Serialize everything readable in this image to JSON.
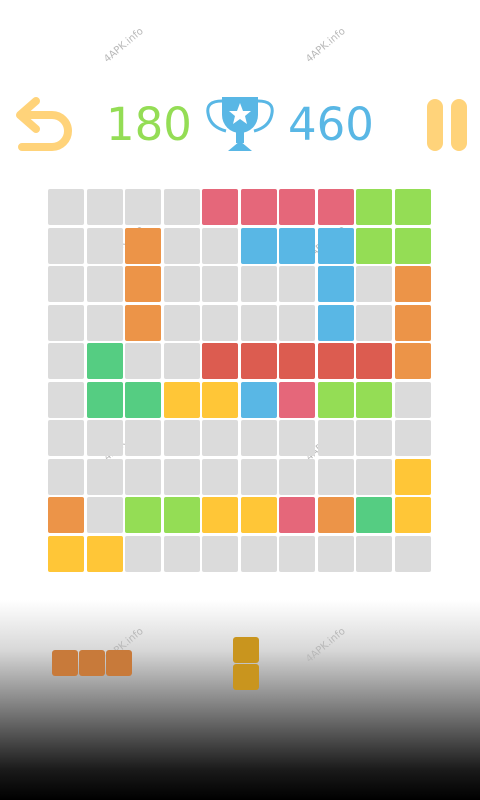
{
  "colors": {
    "empty": "#dbdbdb",
    "R": "#e5677a",
    "G": "#94dd55",
    "B": "#59b7e5",
    "O": "#ec9448",
    "D": "#dc5c50",
    "T": "#55cd82",
    "Y": "#ffc637",
    "undo": "#ffd37a",
    "pause": "#ffd37a",
    "score_current": "#94dd55",
    "score_best": "#59b7e5",
    "trophy": "#59b7e5",
    "tray_piece_orange": "#c87a3a",
    "tray_piece_yellow": "#c9951e"
  },
  "header": {
    "undo_icon": "undo-arrow-icon",
    "current_score": "180",
    "trophy_icon": "trophy-star-icon",
    "best_score": "460",
    "pause_icon": "pause-icon"
  },
  "board": {
    "rows": [
      "....RRRRGG",
      "..O..BBBGG",
      "..O....B.O",
      "..O....B.O",
      ".T..DDDDDO",
      ".TTYYBRGG.",
      "..........",
      ".........Y",
      "O.GGYYROTY",
      "YY........"
    ]
  },
  "tray": {
    "pieces": [
      {
        "color_key": "tray_piece_orange",
        "cells": [
          [
            0,
            0
          ],
          [
            0,
            1
          ],
          [
            0,
            2
          ]
        ]
      },
      {
        "color_key": "tray_piece_yellow",
        "cells": [
          [
            0,
            0
          ],
          [
            1,
            0
          ]
        ]
      }
    ]
  },
  "watermark": "4APK.info"
}
